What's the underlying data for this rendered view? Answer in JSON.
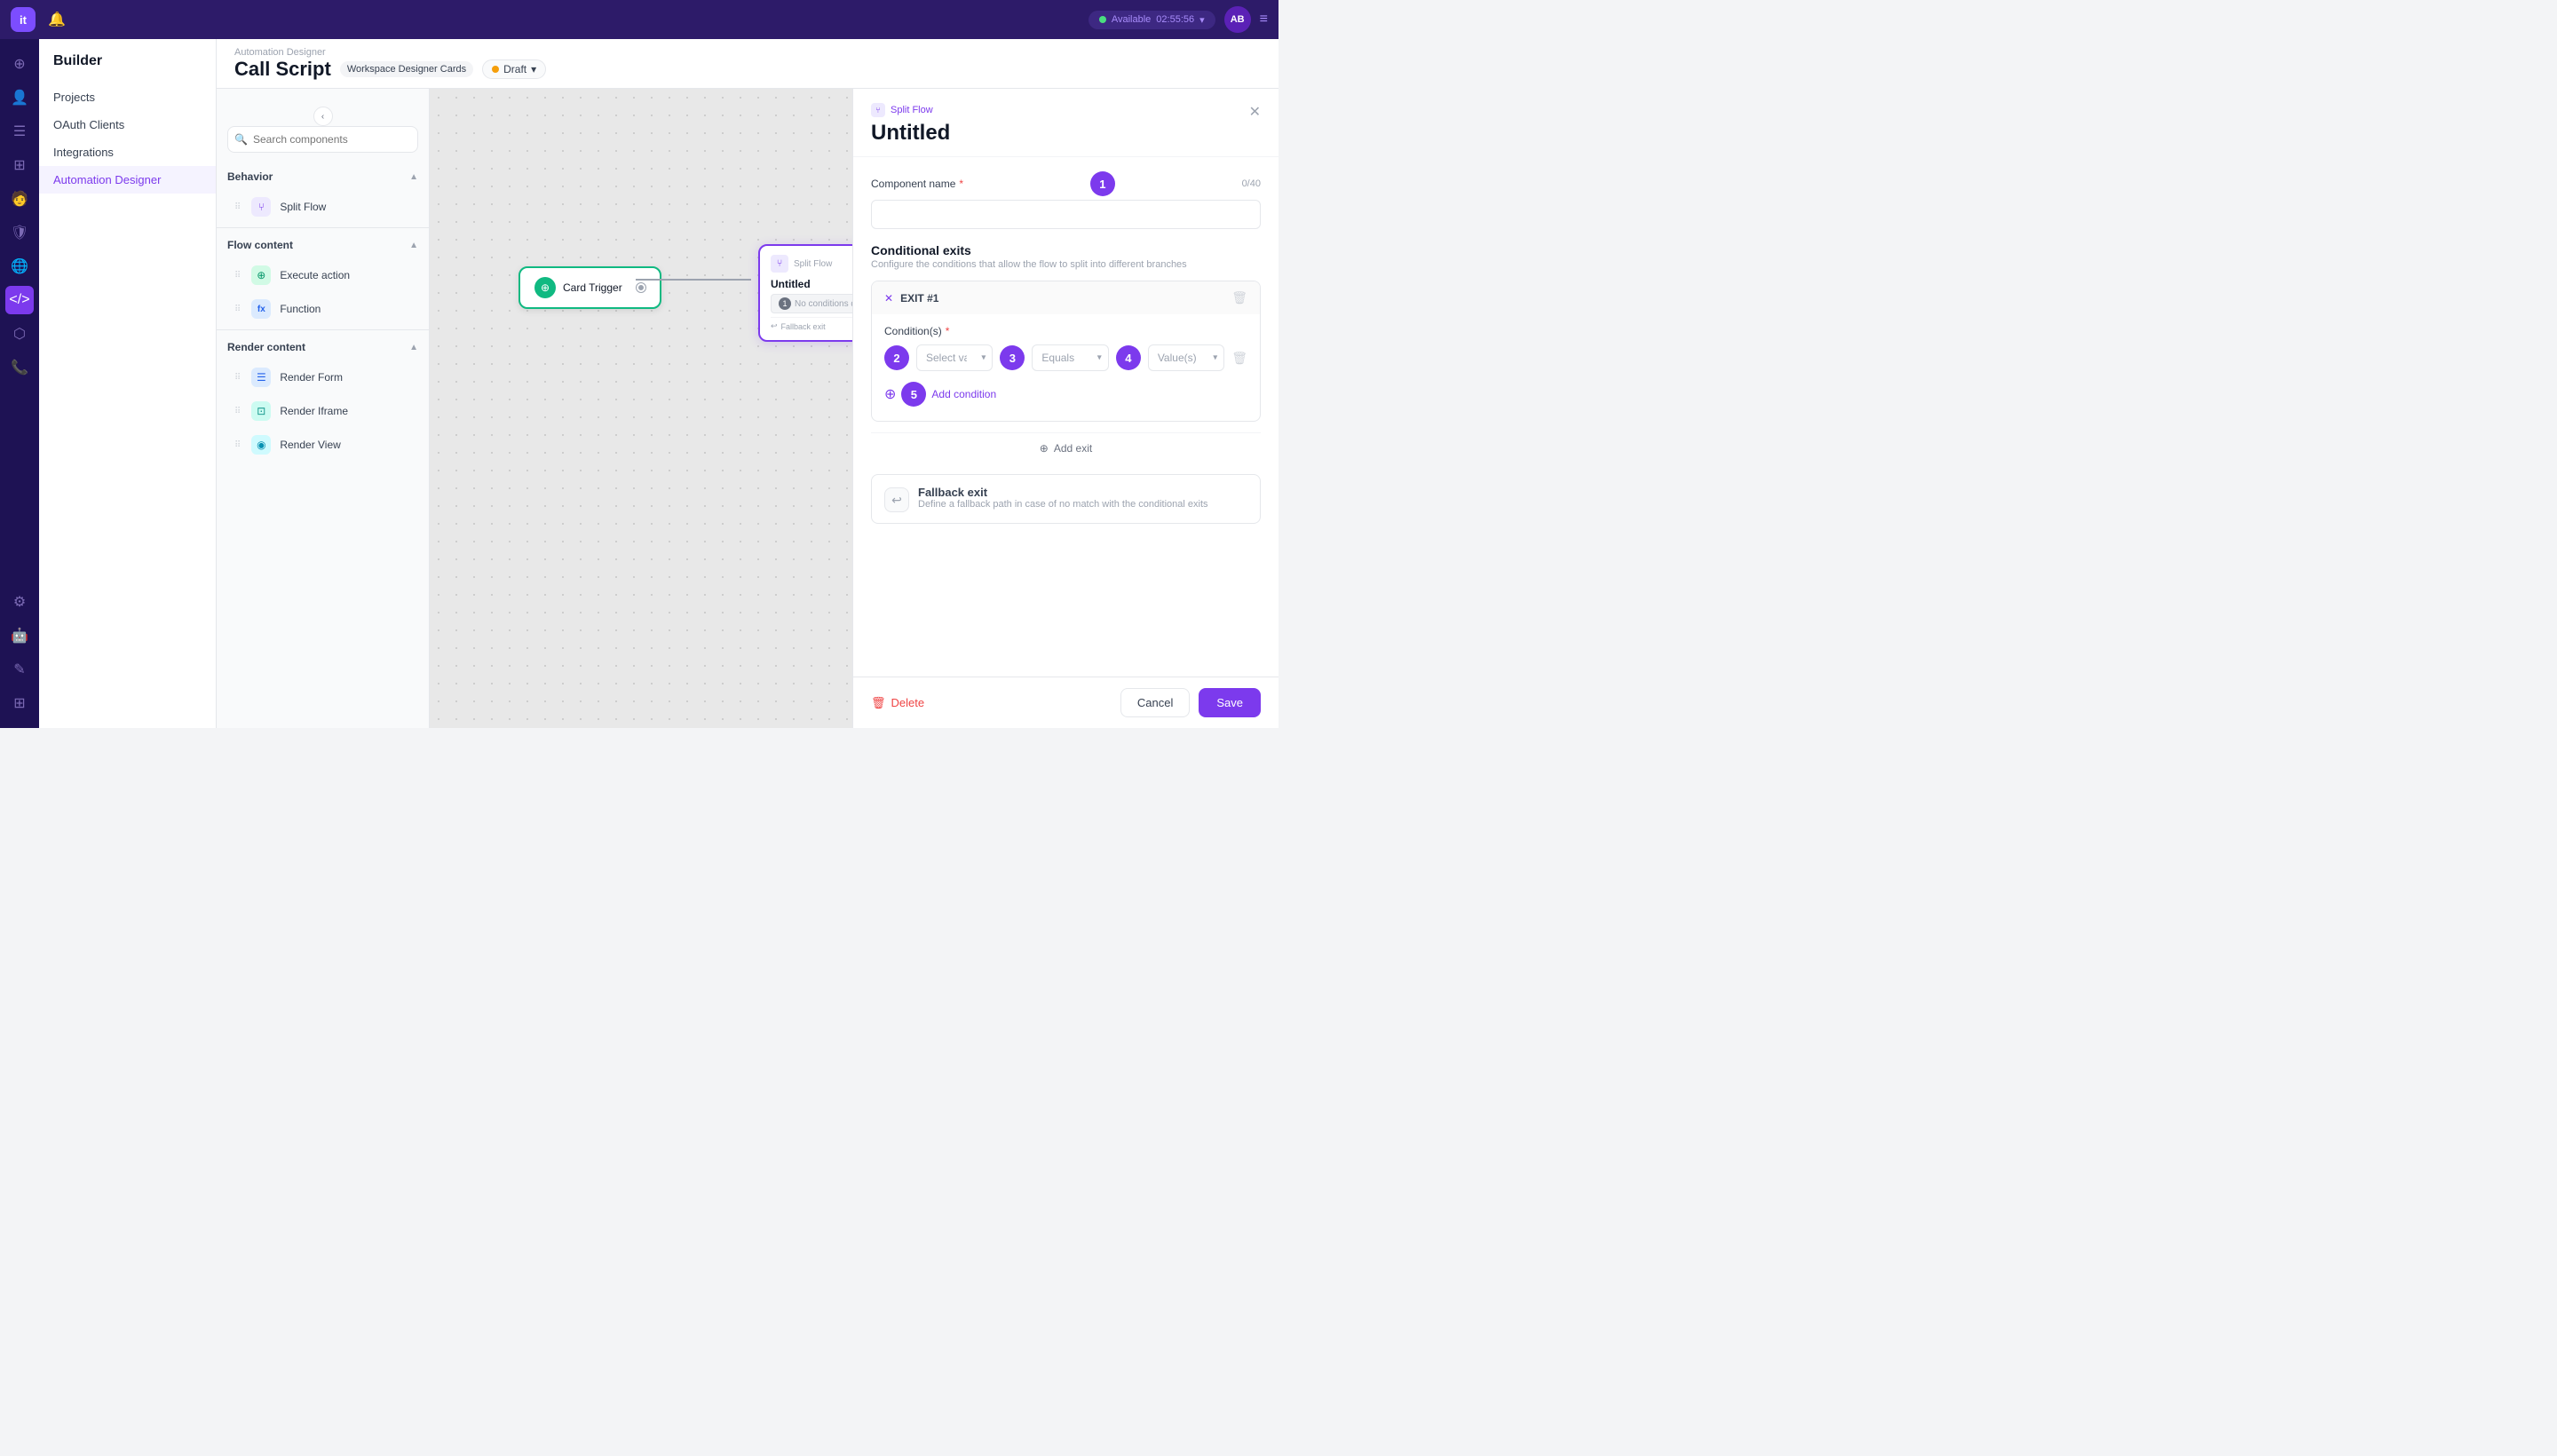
{
  "topbar": {
    "logo": "it",
    "status": "Available",
    "time": "02:55:56",
    "avatar": "AB"
  },
  "nav_sidebar": {
    "title": "Builder",
    "items": [
      {
        "id": "projects",
        "label": "Projects",
        "active": false
      },
      {
        "id": "oauth",
        "label": "OAuth Clients",
        "active": false
      },
      {
        "id": "integrations",
        "label": "Integrations",
        "active": false
      },
      {
        "id": "automation",
        "label": "Automation Designer",
        "active": true
      }
    ]
  },
  "header": {
    "breadcrumb": "Automation Designer",
    "title": "Call Script",
    "workspace_tag": "Workspace Designer Cards",
    "draft_label": "Draft"
  },
  "component_panel": {
    "search_placeholder": "Search components",
    "sections": [
      {
        "id": "behavior",
        "label": "Behavior",
        "items": [
          {
            "id": "split-flow",
            "label": "Split Flow",
            "icon_type": "purple",
            "icon": "⑂"
          }
        ]
      },
      {
        "id": "flow-content",
        "label": "Flow content",
        "items": [
          {
            "id": "execute-action",
            "label": "Execute action",
            "icon_type": "green",
            "icon": "⊕"
          },
          {
            "id": "function",
            "label": "Function",
            "icon_type": "blue",
            "icon": "fx"
          }
        ]
      },
      {
        "id": "render-content",
        "label": "Render content",
        "items": [
          {
            "id": "render-form",
            "label": "Render Form",
            "icon_type": "blue",
            "icon": "☰"
          },
          {
            "id": "render-iframe",
            "label": "Render Iframe",
            "icon_type": "teal",
            "icon": "⊡"
          },
          {
            "id": "render-view",
            "label": "Render View",
            "icon_type": "cyan",
            "icon": "◉"
          }
        ]
      }
    ]
  },
  "canvas": {
    "card_trigger_label": "Card Trigger",
    "split_flow_label": "Split Flow",
    "split_flow_name": "Untitled",
    "no_conditions": "No conditions defined",
    "fallback_exit": "Fallback exit"
  },
  "right_panel": {
    "type_label": "Split Flow",
    "title": "Untitled",
    "component_name_label": "Component name",
    "component_name_required": true,
    "char_count": "0/40",
    "conditional_exits_title": "Conditional exits",
    "conditional_exits_desc": "Configure the conditions that allow the flow to split into different branches",
    "exit_label": "EXIT #1",
    "condition_label": "Condition(s)",
    "select_variable_placeholder": "Select variable",
    "equals_label": "Equals",
    "values_placeholder": "Value(s) or variable",
    "add_condition_label": "Add condition",
    "add_exit_label": "Add exit",
    "fallback_exit_title": "Fallback exit",
    "fallback_exit_desc": "Define a fallback path in case of no match with the conditional exits",
    "delete_label": "Delete",
    "cancel_label": "Cancel",
    "save_label": "Save",
    "steps": [
      "1",
      "2",
      "3",
      "4",
      "5"
    ]
  }
}
